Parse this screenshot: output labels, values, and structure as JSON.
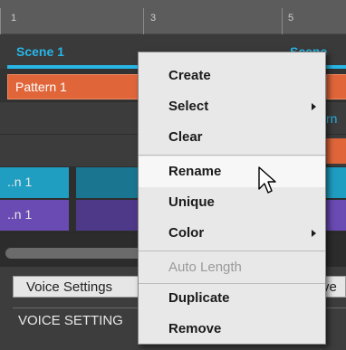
{
  "ruler": {
    "markers": [
      "1",
      "3",
      "5"
    ]
  },
  "scenes": [
    {
      "label": "Scene 1"
    },
    {
      "label": "Scene"
    }
  ],
  "pattern": {
    "label": "Pattern 1",
    "right_fragment": "rn"
  },
  "sounds": [
    {
      "label": "..n 1",
      "color": "#1f9ec2"
    },
    {
      "label": "..n 1",
      "color": "#6a4ab3"
    }
  ],
  "bottom_panel": {
    "tab_label": "Voice Settings",
    "tab2_fragment": "ve",
    "heading": "VOICE SETTING"
  },
  "menu": {
    "items": [
      {
        "label": "Create",
        "submenu": false,
        "disabled": false
      },
      {
        "label": "Select",
        "submenu": true,
        "disabled": false
      },
      {
        "label": "Clear",
        "submenu": false,
        "disabled": false
      },
      {
        "label": "Rename",
        "submenu": false,
        "disabled": false,
        "hover": true
      },
      {
        "label": "Unique",
        "submenu": false,
        "disabled": false
      },
      {
        "label": "Color",
        "submenu": true,
        "disabled": false
      },
      {
        "label": "Auto Length",
        "submenu": false,
        "disabled": true
      },
      {
        "label": "Duplicate",
        "submenu": false,
        "disabled": false
      },
      {
        "label": "Remove",
        "submenu": false,
        "disabled": false
      }
    ]
  },
  "colors": {
    "scene_accent": "#27b6e6",
    "pattern": "#e0663a",
    "menu_bg": "#e8e8e8"
  },
  "icons": {
    "cursor": "arrow-cursor-icon",
    "submenu": "chevron-right-icon"
  }
}
